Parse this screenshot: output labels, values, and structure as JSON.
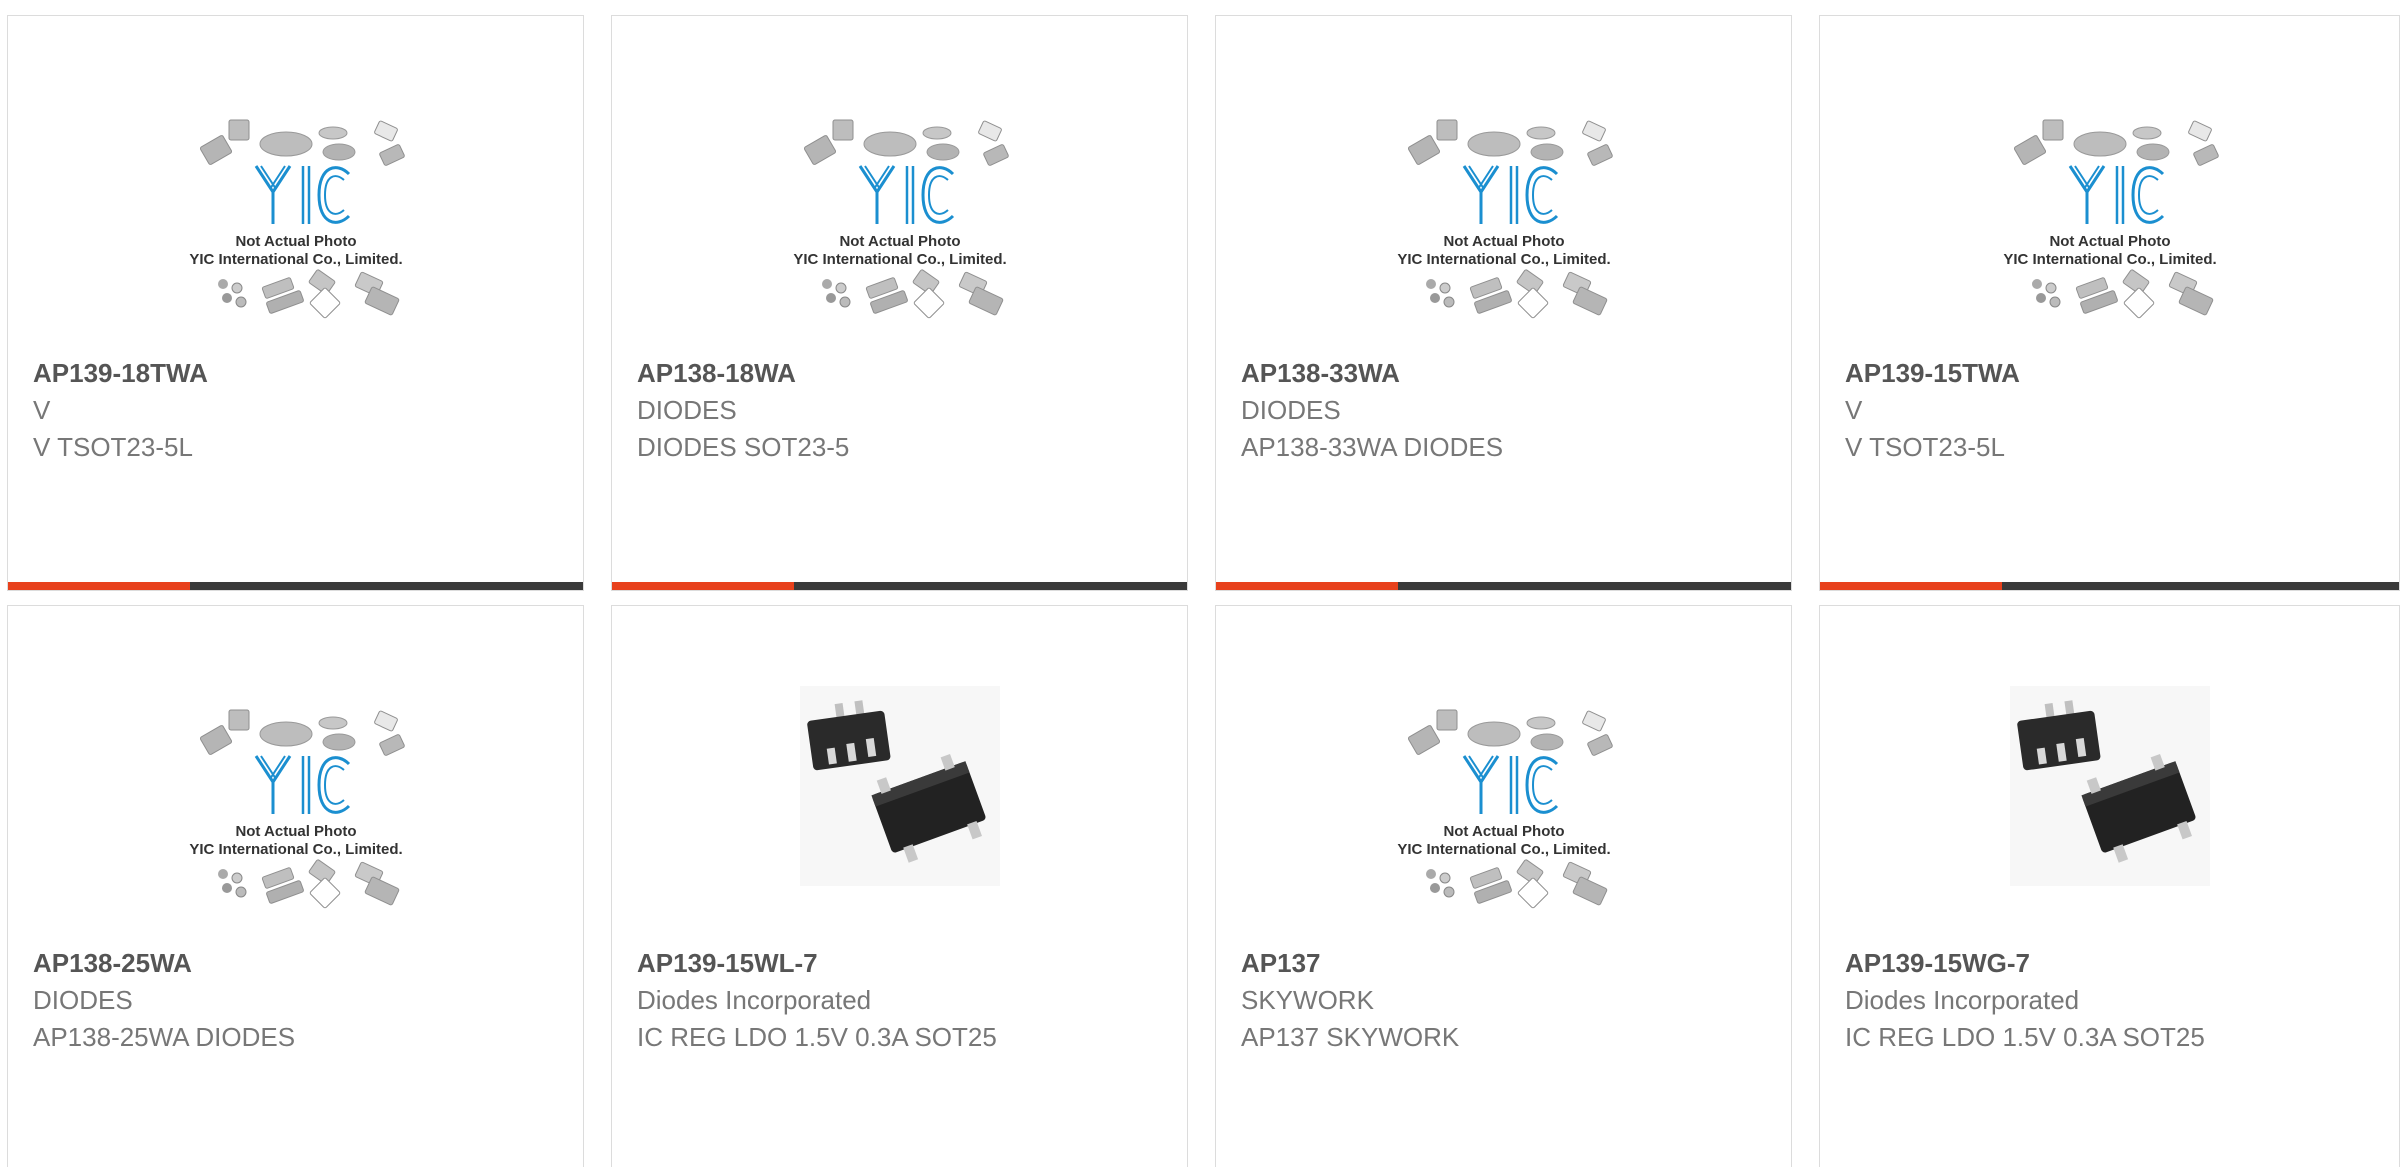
{
  "colors": {
    "accent": "#e8411c",
    "bar": "#3a3a3a",
    "logo_blue": "#1b8fd0",
    "chip_dark": "#2a2a2a"
  },
  "placeholder": {
    "caption_line1": "Not Actual Photo",
    "caption_line2": "YIC International Co., Limited.",
    "logo_text": "YIC"
  },
  "products": [
    {
      "part": "AP139-18TWA",
      "manufacturer": "V",
      "description": "V TSOT23-5L",
      "image": "yic-placeholder",
      "hover_bar": true
    },
    {
      "part": "AP138-18WA",
      "manufacturer": "DIODES",
      "description": "DIODES SOT23-5",
      "image": "yic-placeholder",
      "hover_bar": true
    },
    {
      "part": "AP138-33WA",
      "manufacturer": "DIODES",
      "description": "AP138-33WA DIODES",
      "image": "yic-placeholder",
      "hover_bar": true
    },
    {
      "part": "AP139-15TWA",
      "manufacturer": "V",
      "description": "V TSOT23-5L",
      "image": "yic-placeholder",
      "hover_bar": true
    },
    {
      "part": "AP138-25WA",
      "manufacturer": "DIODES",
      "description": "AP138-25WA DIODES",
      "image": "yic-placeholder",
      "hover_bar": false
    },
    {
      "part": "AP139-15WL-7",
      "manufacturer": "Diodes Incorporated",
      "description": "IC REG LDO 1.5V 0.3A SOT25",
      "image": "sot25-photo",
      "hover_bar": false
    },
    {
      "part": "AP137",
      "manufacturer": "SKYWORK",
      "description": "AP137 SKYWORK",
      "image": "yic-placeholder",
      "hover_bar": false
    },
    {
      "part": "AP139-15WG-7",
      "manufacturer": "Diodes Incorporated",
      "description": "IC REG LDO 1.5V 0.3A SOT25",
      "image": "sot25-photo",
      "hover_bar": false
    }
  ]
}
